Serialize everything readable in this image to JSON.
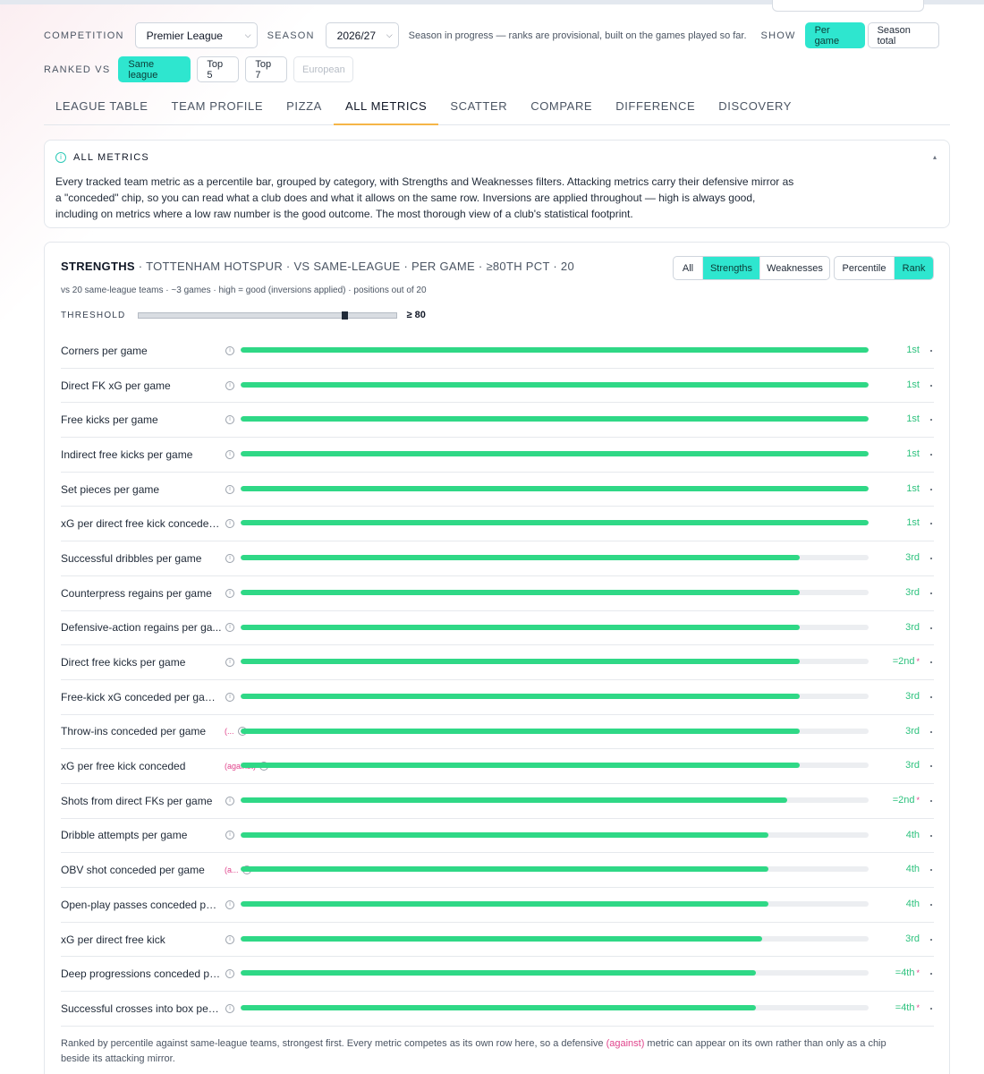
{
  "controls": {
    "competition_label": "COMPETITION",
    "competition_value": "Premier League",
    "season_label": "SEASON",
    "season_value": "2026/27",
    "season_note": "Season in progress — ranks are provisional, built on the games played so far.",
    "show_label": "SHOW",
    "show_options": [
      "Per game",
      "Season total"
    ],
    "ranked_label": "RANKED VS",
    "ranked_options": [
      "Same league",
      "Top 5",
      "Top 7",
      "European"
    ]
  },
  "tabs": [
    "LEAGUE TABLE",
    "TEAM PROFILE",
    "PIZZA",
    "ALL METRICS",
    "SCATTER",
    "COMPARE",
    "DIFFERENCE",
    "DISCOVERY"
  ],
  "active_tab": "ALL METRICS",
  "info": {
    "title": "ALL METRICS",
    "toggle": "▴",
    "text": "Every tracked team metric as a percentile bar, grouped by category, with Strengths and Weaknesses filters. Attacking metrics carry their defensive mirror as a \"conceded\" chip, so you can read what a club does and what it allows on the same row. Inversions are applied throughout — high is always good, including on metrics where a low raw number is the good outcome. The most thorough view of a club's statistical footprint."
  },
  "panel": {
    "title_bold": "STRENGTHS",
    "title_rest": " · TOTTENHAM HOTSPUR · VS SAME-LEAGUE · PER GAME · ≥80TH PCT · 20",
    "subtitle": "vs 20 same-league teams · ~3 games · high = good (inversions applied) · positions out of 20",
    "filter_options": [
      "All",
      "Strengths",
      "Weaknesses"
    ],
    "filter_active": "Strengths",
    "mode_options": [
      "Percentile",
      "Rank"
    ],
    "mode_active": "Rank",
    "threshold_label": "THRESHOLD",
    "threshold_value": 80,
    "threshold_text": "≥ 80",
    "footer_before": "Ranked by percentile against same-league teams, strongest first. Every metric competes as its own row here, so a defensive ",
    "footer_chip": "(against)",
    "footer_after": " metric can appear on its own rather than only as a chip beside its attacking mirror."
  },
  "rows": [
    {
      "name": "Corners per game",
      "chip": "",
      "pct": 100,
      "rank": "1st",
      "tied": false
    },
    {
      "name": "Direct FK xG per game",
      "chip": "",
      "pct": 100,
      "rank": "1st",
      "tied": false
    },
    {
      "name": "Free kicks per game",
      "chip": "",
      "pct": 100,
      "rank": "1st",
      "tied": false
    },
    {
      "name": "Indirect free kicks per game",
      "chip": "",
      "pct": 100,
      "rank": "1st",
      "tied": false
    },
    {
      "name": "Set pieces per game",
      "chip": "",
      "pct": 100,
      "rank": "1st",
      "tied": false
    },
    {
      "name": "xG per direct free kick conceded...",
      "chip": "",
      "pct": 100,
      "rank": "1st",
      "tied": false
    },
    {
      "name": "Successful dribbles per game",
      "chip": "",
      "pct": 89,
      "rank": "3rd",
      "tied": false
    },
    {
      "name": "Counterpress regains per game",
      "chip": "",
      "pct": 89,
      "rank": "3rd",
      "tied": false
    },
    {
      "name": "Defensive-action regains per ga...",
      "chip": "",
      "pct": 89,
      "rank": "3rd",
      "tied": false
    },
    {
      "name": "Direct free kicks per game",
      "chip": "",
      "pct": 89,
      "rank": "=2nd",
      "tied": true
    },
    {
      "name": "Free-kick xG conceded per gam...",
      "chip": "",
      "pct": 89,
      "rank": "3rd",
      "tied": false
    },
    {
      "name": "Throw-ins conceded per game",
      "chip": "(...",
      "pct": 89,
      "rank": "3rd",
      "tied": false
    },
    {
      "name": "xG per free kick conceded",
      "chip": "(against)",
      "pct": 89,
      "rank": "3rd",
      "tied": false
    },
    {
      "name": "Shots from direct FKs per game",
      "chip": "",
      "pct": 87,
      "rank": "=2nd",
      "tied": true
    },
    {
      "name": "Dribble attempts per game",
      "chip": "",
      "pct": 84,
      "rank": "4th",
      "tied": false
    },
    {
      "name": "OBV shot conceded per game",
      "chip": "(a...",
      "pct": 84,
      "rank": "4th",
      "tied": false
    },
    {
      "name": "Open-play passes conceded per ...",
      "chip": "",
      "pct": 84,
      "rank": "4th",
      "tied": false
    },
    {
      "name": "xG per direct free kick",
      "chip": "",
      "pct": 83,
      "rank": "3rd",
      "tied": false
    },
    {
      "name": "Deep progressions conceded pe...",
      "chip": "",
      "pct": 82,
      "rank": "=4th",
      "tied": true
    },
    {
      "name": "Successful crosses into box per ...",
      "chip": "",
      "pct": 82,
      "rank": "=4th",
      "tied": true
    }
  ]
}
